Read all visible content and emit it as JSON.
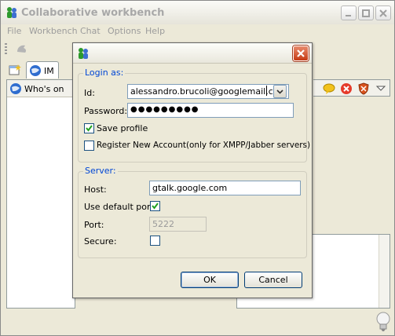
{
  "window": {
    "title": "Collaborative workbench"
  },
  "menu": [
    "File",
    "Workbench",
    "Chat",
    "Options",
    "Help"
  ],
  "tabs": {
    "im": "IM"
  },
  "panels": {
    "whos_online": "Who's on"
  },
  "dialog": {
    "login_group": "Login as:",
    "id_label": "Id:",
    "id_value": "alessandro.brucoli@googlemail.com",
    "password_label": "Password:",
    "password_value": "●●●●●●●●●",
    "save_profile_label": "Save profile",
    "save_profile_checked": true,
    "register_label": "Register New Account(only for XMPP/Jabber servers)",
    "register_checked": false,
    "server_group": "Server:",
    "host_label": "Host:",
    "host_value": "gtalk.google.com",
    "default_port_label": "Use default port",
    "default_port_checked": true,
    "port_label": "Port:",
    "port_value": "5222",
    "secure_label": "Secure:",
    "secure_checked": false,
    "ok_label": "OK",
    "cancel_label": "Cancel"
  },
  "colors": {
    "group_label": "#0046d5",
    "close_button": "#c63a14",
    "check": "#21a121"
  }
}
